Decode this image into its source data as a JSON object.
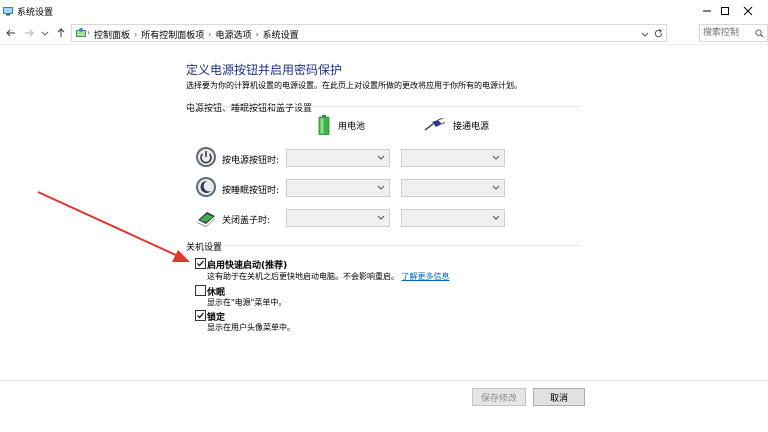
{
  "window": {
    "title": "系统设置",
    "minimize_icon": "minimize-icon",
    "maximize_icon": "maximize-icon",
    "close_icon": "close-icon"
  },
  "address_bar": {
    "breadcrumbs": [
      "控制面板",
      "所有控制面板项",
      "电源选项",
      "系统设置"
    ],
    "search_placeholder": "搜索控制"
  },
  "page": {
    "heading": "定义电源按钮并启用密码保护",
    "subtitle": "选择要为你的计算机设置的电源设置。在此页上对设置所做的更改将应用于你所有的电源计划。",
    "power_section": {
      "label": "电源按钮、睡眠按钮和盖子设置",
      "columns": [
        "用电池",
        "接通电源"
      ],
      "rows": [
        {
          "label": "按电源按钮时:",
          "icon": "power-icon",
          "battery_value": "",
          "ac_value": ""
        },
        {
          "label": "按睡眠按钮时:",
          "icon": "sleep-icon",
          "battery_value": "",
          "ac_value": ""
        },
        {
          "label": "关闭盖子时:",
          "icon": "laptop-lid-icon",
          "battery_value": "",
          "ac_value": ""
        }
      ]
    },
    "shutdown_section": {
      "label": "关机设置",
      "options": [
        {
          "title": "启用快速启动(推荐)",
          "desc": "这有助于在关机之后更快地启动电脑。不会影响重启。",
          "link": "了解更多信息",
          "checked": true
        },
        {
          "title": "休眠",
          "desc": "显示在\"电源\"菜单中。",
          "checked": false
        },
        {
          "title": "锁定",
          "desc": "显示在用户头像菜单中。",
          "checked": true
        }
      ]
    }
  },
  "buttons": {
    "save": "保存修改",
    "cancel": "取消"
  },
  "colors": {
    "heading": "#1e3287",
    "link": "#0066cc",
    "annotation_arrow": "#e0362b"
  }
}
